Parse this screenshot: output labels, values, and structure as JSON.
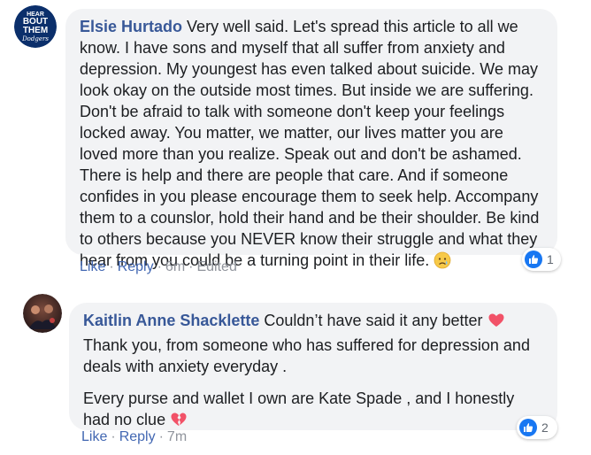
{
  "comments": [
    {
      "author": "Elsie Hurtado",
      "avatar_text": [
        "HEAR",
        "BOUT",
        "THEM",
        "Dodgers"
      ],
      "text": "Very well said. Let's spread this article to all we know. I have sons and myself that all suffer from anxiety and depression. My youngest has even talked about suicide. We may look okay on the outside most times. But inside we are suffering. Don't be afraid to talk with someone don't keep your feelings locked away. You matter, we matter, our lives matter you are loved more than you realize. Speak out and don't be ashamed. There is help and there are people that care. And if someone confides in you please encourage them to seek help. Accompany them to a counslor, hold their hand and be their shoulder. Be kind to others because you NEVER know their struggle and what they hear from you could be a turning point in their life.",
      "emoji": "sad-tear-face-icon",
      "actions": {
        "like": "Like",
        "reply": "Reply",
        "time": "6m",
        "edited": "Edited"
      },
      "reactions": {
        "type": "like-icon",
        "count": "1"
      }
    },
    {
      "author": "Kaitlin Anne Shacklette",
      "first_line": "Couldn’t have said it any better",
      "first_line_emoji": "heart-icon",
      "para1_rest": "Thank you, from someone who has suffered for depression and deals with anxiety everyday .",
      "para2": "Every purse and wallet I own are Kate Spade , and I honestly had no clue",
      "para2_emoji": "broken-heart-icon",
      "actions": {
        "like": "Like",
        "reply": "Reply",
        "time": "7m"
      },
      "reactions": {
        "type": "like-icon",
        "count": "2"
      }
    }
  ],
  "colors": {
    "author_link": "#385898",
    "action_link": "#4267b2",
    "meta_text": "#90949c",
    "bubble_bg": "#f2f3f5",
    "like_blue": "#1877f2",
    "heart_pink": "#f25268"
  }
}
